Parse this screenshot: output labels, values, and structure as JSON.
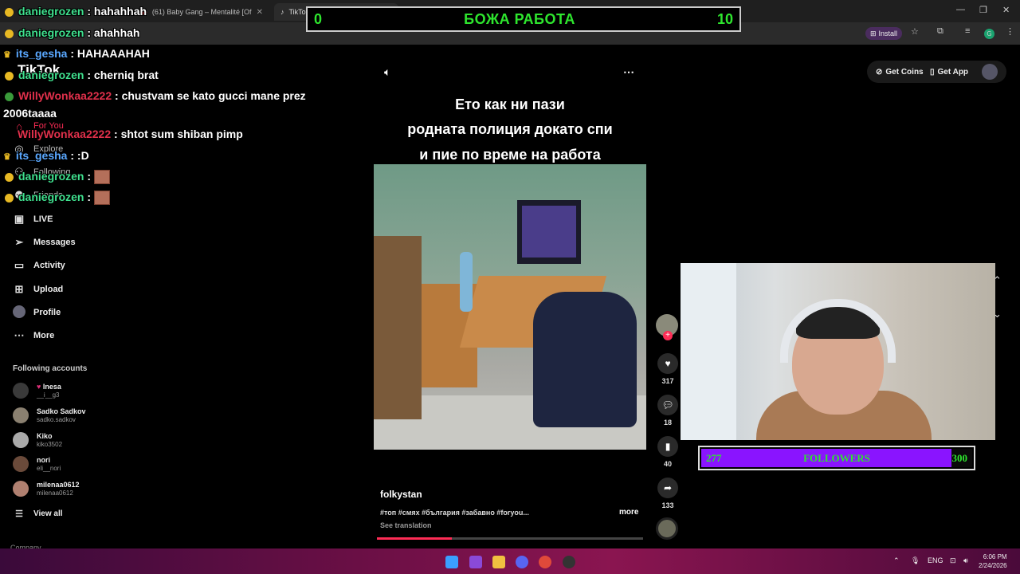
{
  "browser": {
    "tabs": [
      {
        "label": "(61) Baby Gang – Mentalité [Of"
      },
      {
        "label": "TikTok – Make Your Day"
      }
    ],
    "new_tab": "+",
    "install_label": "Install",
    "profile_letter": "G"
  },
  "scoreboard": {
    "left_score": "0",
    "title": "БОЖА РАБОТА",
    "right_score": "10"
  },
  "chat": [
    {
      "user": "daniegrozen",
      "color": "green",
      "message": "hahahhah",
      "badge": "sub"
    },
    {
      "user": "daniegrozen",
      "color": "green",
      "message": "ahahhah",
      "badge": "sub"
    },
    {
      "user": "its_gesha",
      "color": "blue",
      "message": "HAHAAAHAH",
      "badge": "crown"
    },
    {
      "user": "daniegrozen",
      "color": "green",
      "message": "cherniq brat",
      "badge": "sub"
    },
    {
      "user": "WillyWonkaa2222",
      "color": "red",
      "message": "chustvam se kato gucci mane prez",
      "badge": "sub"
    },
    {
      "user": "",
      "color": "white",
      "message": "2006taaaa",
      "badge": ""
    },
    {
      "user": "WillyWonkaa2222",
      "color": "red",
      "message": "shtot sum shiban pimp",
      "badge": ""
    },
    {
      "user": "its_gesha",
      "color": "blue",
      "message": ":D",
      "badge": "crown"
    },
    {
      "user": "daniegrozen",
      "color": "green",
      "message": "",
      "badge": "sub",
      "emote": true
    },
    {
      "user": "daniegrozen",
      "color": "green",
      "message": "",
      "badge": "sub",
      "emote": true
    }
  ],
  "tiktok": {
    "logo": "TikTok",
    "nav": [
      {
        "label": "For You",
        "icon": "home-icon"
      },
      {
        "label": "Explore",
        "icon": "compass-icon"
      },
      {
        "label": "Following",
        "icon": "users-icon"
      },
      {
        "label": "Friends",
        "icon": "friends-icon"
      },
      {
        "label": "LIVE",
        "icon": "live-icon"
      },
      {
        "label": "Messages",
        "icon": "send-icon"
      },
      {
        "label": "Activity",
        "icon": "activity-icon"
      },
      {
        "label": "Upload",
        "icon": "plus-box-icon"
      },
      {
        "label": "Profile",
        "icon": "avatar-icon"
      },
      {
        "label": "More",
        "icon": "more-icon"
      }
    ],
    "following_title": "Following accounts",
    "accounts": [
      {
        "name": "Inesa",
        "handle": "__i__g3"
      },
      {
        "name": "Sadko Sadkov",
        "handle": "sadko.sadkov"
      },
      {
        "name": "Kiko",
        "handle": "kiko3502"
      },
      {
        "name": "nori",
        "handle": "eli__nori"
      },
      {
        "name": "milenaa0612",
        "handle": "milenaa0612"
      }
    ],
    "view_all": "View all",
    "company": "Company",
    "get_coins": "Get Coins",
    "get_app": "Get App"
  },
  "video": {
    "caption_lines": [
      "Ето как ни пази",
      "родната полиция докато спи",
      "и пие по време на работа"
    ],
    "likes": "317",
    "comments": "18",
    "saves": "40",
    "shares": "133",
    "author": "folkystan",
    "tags": "#топ #смях #българия #забавно #foryou...",
    "more": "more",
    "see_translation": "See translation",
    "progress": 0.28
  },
  "followers_goal": {
    "current": "277",
    "label": "FOLLOWERS",
    "target": "300",
    "fraction": 0.923
  },
  "taskbar": {
    "lang": "ENG",
    "time": "6:06 PM",
    "date": "2/24/2026"
  },
  "colors": {
    "score_green": "#2ee62e",
    "followers_purple": "#8a14ff",
    "tiktok_red": "#fe2c55"
  }
}
